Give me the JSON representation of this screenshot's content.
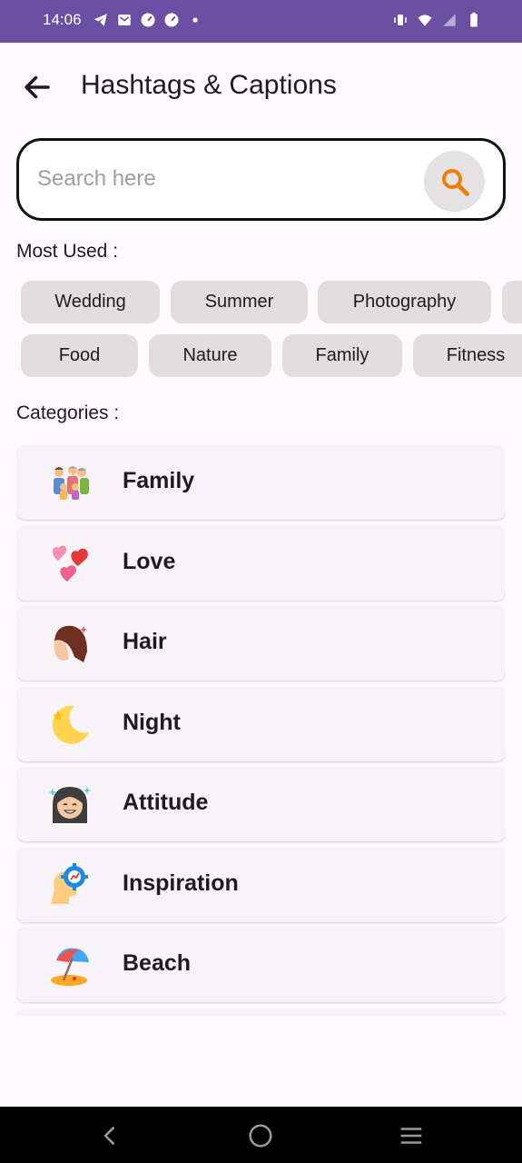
{
  "status_bar": {
    "time": "14:06",
    "left_icons": [
      "telegram-icon",
      "mail-icon",
      "speed-icon",
      "speed-icon",
      "dot-icon"
    ],
    "right_icons": [
      "vibrate-icon",
      "wifi-icon",
      "signal-icon",
      "battery-icon"
    ]
  },
  "header": {
    "title": "Hashtags & Captions",
    "back_icon": "arrow-back-icon"
  },
  "search": {
    "placeholder": "Search here",
    "value": "",
    "icon": "search-icon",
    "accent": "#F57C00"
  },
  "most_used": {
    "label": "Most Used :",
    "row1": [
      "Wedding",
      "Summer",
      "Photography",
      ""
    ],
    "row2": [
      "Food",
      "Nature",
      "Family",
      "Fitness"
    ]
  },
  "categories": {
    "label": "Categories :",
    "items": [
      {
        "label": "Family",
        "icon": "family-icon"
      },
      {
        "label": "Love",
        "icon": "hearts-icon"
      },
      {
        "label": "Hair",
        "icon": "hair-icon"
      },
      {
        "label": "Night",
        "icon": "moon-icon"
      },
      {
        "label": "Attitude",
        "icon": "attitude-icon"
      },
      {
        "label": "Inspiration",
        "icon": "inspiration-icon"
      },
      {
        "label": "Beach",
        "icon": "beach-umbrella-icon"
      },
      {
        "label": "",
        "icon": ""
      }
    ]
  },
  "nav": {
    "back": "nav-back-icon",
    "home": "nav-home-icon",
    "menu": "nav-menu-icon"
  },
  "colors": {
    "status_bar": "#6A4FA3",
    "chip_bg": "#E0DEDE",
    "card_bg": "#F7F3F7",
    "search_icon": "#F57C00"
  }
}
